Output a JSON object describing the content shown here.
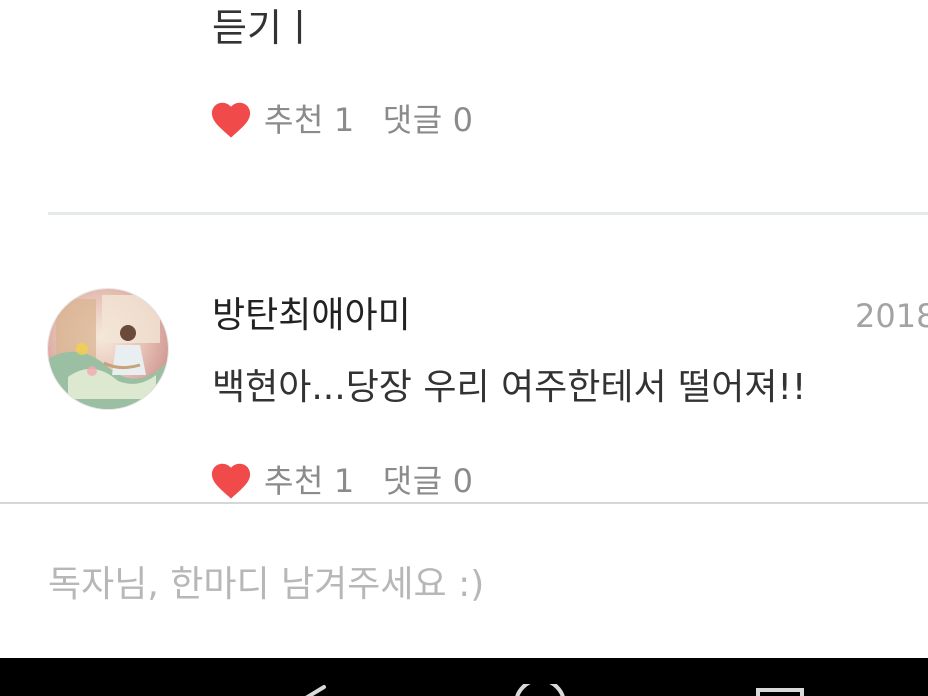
{
  "previous_comment": {
    "text_tail": "듣기ㅣ",
    "like_label": "추천",
    "like_count": "1",
    "reply_label": "댓글",
    "reply_count": "0"
  },
  "comment": {
    "author": "방탄최애아미",
    "date": "2018",
    "body": "백현아...당장 우리 여주한테서 떨어져!!",
    "like_label": "추천",
    "like_count": "1",
    "reply_label": "댓글",
    "reply_count": "0"
  },
  "comment_input": {
    "placeholder": "독자님, 한마디 남겨주세요 :)",
    "value": ""
  },
  "icons": {
    "like": "heart-icon",
    "nav_back": "back-triangle-icon",
    "nav_home": "home-circle-icon",
    "nav_recents": "recents-square-icon"
  },
  "colors": {
    "heart": "#f04a4a",
    "navbar": "#000000",
    "divider": "#e6eaea"
  }
}
